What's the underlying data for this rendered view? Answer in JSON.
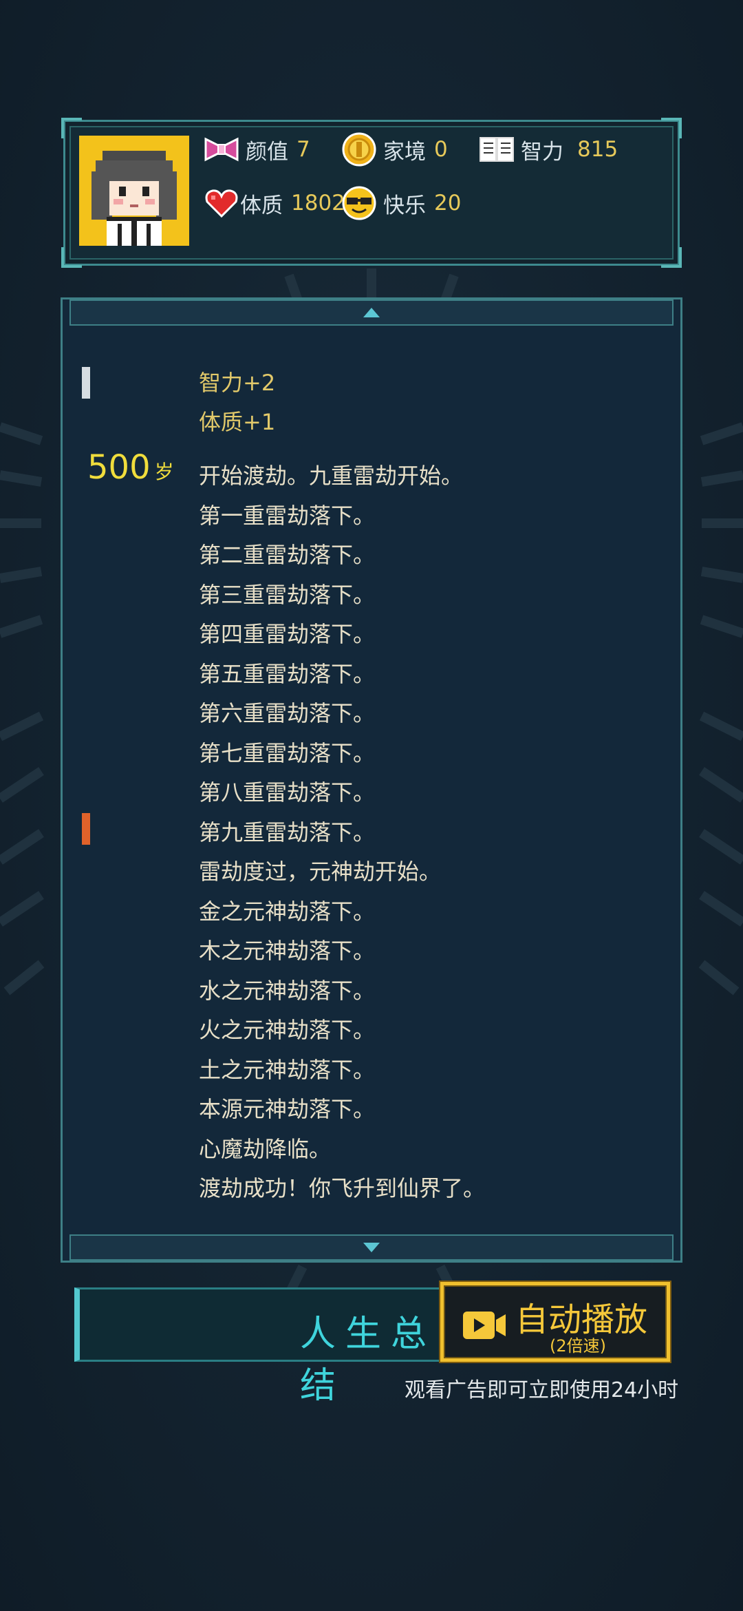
{
  "stats": {
    "appearance": {
      "label": "颜值",
      "value": "7",
      "icon": "bow-icon"
    },
    "family": {
      "label": "家境",
      "value": "0",
      "icon": "coin-icon"
    },
    "intelligence": {
      "label": "智力",
      "value": "815",
      "icon": "book-icon"
    },
    "constitution": {
      "label": "体质",
      "value": "1802",
      "icon": "heart-icon"
    },
    "happiness": {
      "label": "快乐",
      "value": "20",
      "icon": "sunglasses-face-icon"
    }
  },
  "log": {
    "previous_gains": [
      "智力+2",
      "体质+1"
    ],
    "age_value": "500",
    "age_unit": "岁",
    "events": [
      "开始渡劫。九重雷劫开始。",
      "第一重雷劫落下。",
      "第二重雷劫落下。",
      "第三重雷劫落下。",
      "第四重雷劫落下。",
      "第五重雷劫落下。",
      "第六重雷劫落下。",
      "第七重雷劫落下。",
      "第八重雷劫落下。",
      "第九重雷劫落下。",
      "雷劫度过，元神劫开始。",
      "金之元神劫落下。",
      "木之元神劫落下。",
      "水之元神劫落下。",
      "火之元神劫落下。",
      "土之元神劫落下。",
      "本源元神劫落下。",
      "心魔劫降临。",
      "渡劫成功！你飞升到仙界了。"
    ]
  },
  "buttons": {
    "summary_label": "人生总结",
    "auto_play_label": "自动播放",
    "auto_play_speed": "(2倍速)"
  },
  "ad_note": "观看广告即可立即使用24小时",
  "colors": {
    "accent_teal": "#3fd4dc",
    "gold": "#f0c02e",
    "value_yellow": "#e6c95a"
  }
}
